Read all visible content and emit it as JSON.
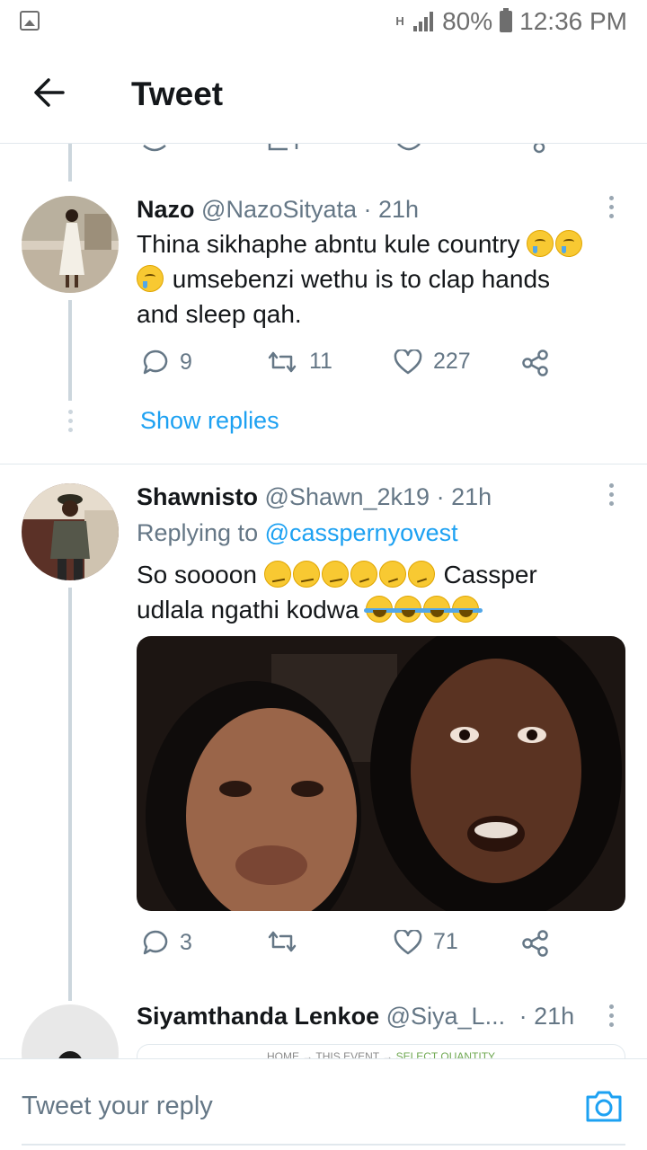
{
  "status_bar": {
    "network_label": "H",
    "battery": "80%",
    "time": "12:36 PM"
  },
  "header": {
    "title": "Tweet"
  },
  "tweets": [
    {
      "name": "Nazo",
      "handle": "@NazoSityata",
      "time": "· 21h",
      "text_line1": "Thina sikhaphe abntu kule country",
      "text_line2": "umsebenzi wethu is to clap hands",
      "text_line3": "and sleep qah.",
      "replies": "9",
      "retweets": "11",
      "likes": "227"
    },
    {
      "name": "Shawnisto",
      "handle": "@Shawn_2k19",
      "time": "· 21h",
      "replying_prefix": "Replying to",
      "replying_handle": "@casspernyovest",
      "text_line1_start": "So soooon",
      "text_line1_end": "Cassper",
      "text_line2": "udlala ngathi kodwa",
      "replies": "3",
      "retweets": "",
      "likes": "71"
    },
    {
      "name": "Siyamthanda Lenkoe",
      "handle": "@Siya_L...",
      "time": "· 21h",
      "card_home": "HOME",
      "card_event": "THIS EVENT",
      "card_select": "SELECT QUANTITY"
    }
  ],
  "show_replies_label": "Show replies",
  "reply_bar": {
    "placeholder": "Tweet your reply"
  },
  "colors": {
    "accent": "#1da1f2",
    "secondary_text": "#657786",
    "thread_line": "#ccd6dd"
  },
  "icons": [
    "back-arrow-icon",
    "reply-icon",
    "retweet-icon",
    "like-icon",
    "share-icon",
    "more-options-icon",
    "camera-icon"
  ]
}
